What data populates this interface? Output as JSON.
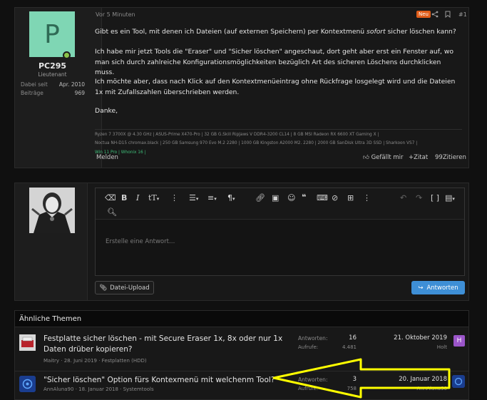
{
  "post": {
    "user": {
      "initial": "P",
      "name": "PC295",
      "rank": "Lieutenant",
      "joined_label": "Dabei seit",
      "joined_value": "Apr. 2010",
      "posts_label": "Beiträge",
      "posts_value": "969"
    },
    "time": "Vor 5 Minuten",
    "new_badge": "Neu",
    "post_number": "#1",
    "paragraphs": {
      "p1a": "Gibt es ein Tool, mit denen ich Dateien (auf externen Speichern) per Kontextmenü ",
      "p1em": "sofort",
      "p1b": " sicher löschen kann?",
      "p2": "Ich habe mir jetzt Tools die \"Eraser\" und \"Sicher löschen\" angeschaut, dort geht aber erst ein Fenster auf, wo man sich durch zahlreiche Konfigurationsmöglichkeiten bezüglich Art des sicheren Löschens durchklicken muss.",
      "p3": "Ich möchte aber, dass nach Klick auf den Kontextmenüeintrag ohne Rückfrage losgelegt wird und die Dateien 1x mit Zufallszahlen überschrieben werden.",
      "p4": "Danke,"
    },
    "signature": {
      "line1": "Ryzen 7 3700X @ 4.30 GHz | ASUS-Prime X470-Pro | 32 GB G.Skill RipJaws V DDR4-3200 CL14 | 8 GB MSI Radeon RX 6600 XT Gaming X |",
      "line2": "Noctua NH-D15 chromax.black | 250 GB Samsung 970 Evo M.2 2280 | 1000 GB Kingston A2000 M2. 2280 | 2000 GB SanDisk Ultra 3D SSD | Sharkoon VS7 |",
      "line3": "Win 11 Pro | Whonix 16 |"
    },
    "actions": {
      "report": "Melden",
      "like": "Gefällt mir",
      "quote": "Zitat",
      "cite": "Zitieren"
    }
  },
  "reply": {
    "placeholder": "Erstelle eine Antwort…",
    "upload_label": "Datei-Upload",
    "submit_label": "Antworten"
  },
  "similar": {
    "heading": "Ähnliche Themen",
    "threads": [
      {
        "title_line1": "Festplatte sicher löschen - mit Secure Eraser 1x, 8x oder nur 1x",
        "title_line2": "Daten drüber kopieren?",
        "meta": "Maitry · 28. Juni 2019 · Festplatten (HDD)",
        "replies_label": "Antworten:",
        "replies": "16",
        "views_label": "Aufrufe:",
        "views": "4.481",
        "last_date": "21. Oktober 2019",
        "last_user": "Holt",
        "last_user_initial": "H"
      },
      {
        "title_line1": "\"Sicher löschen\" Option fürs Kontexmenü mit welchenm Tool?",
        "meta": "AnnAluna90 · 18. Januar 2018 · Systemtools",
        "replies_label": "Antworten:",
        "replies": "3",
        "views_label": "Aufrufe:",
        "views": "758",
        "last_date": "20. Januar 2018",
        "last_user": "AnnAluna90"
      }
    ]
  },
  "colors": {
    "accent": "#3e8fd6",
    "new_badge": "#e05d1a",
    "annotation": "#ffff00",
    "avatar_bg": "#7fd6b4"
  }
}
